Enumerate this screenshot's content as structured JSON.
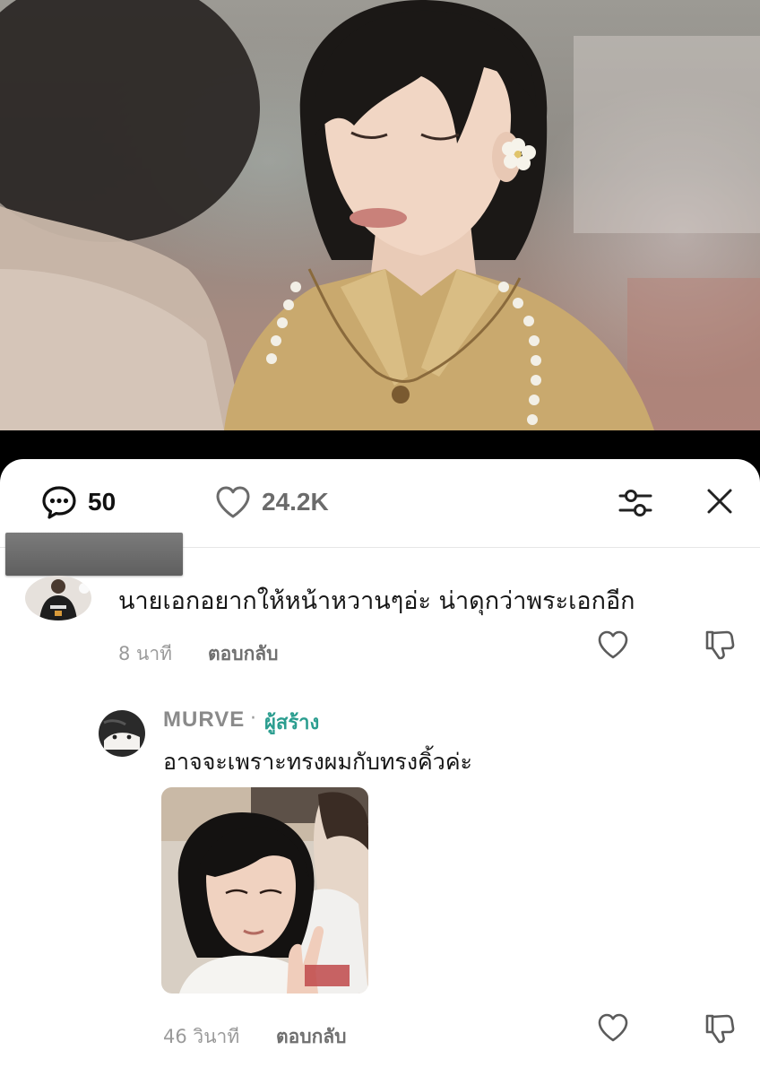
{
  "header": {
    "comment_count": "50",
    "like_count": "24.2K"
  },
  "comments": [
    {
      "text": "นายเอกอยากให้หน้าหวานๆอ่ะ น่าดุกว่าพระเอกอีก",
      "time": "8 นาที",
      "reply_label": "ตอบกลับ"
    }
  ],
  "reply": {
    "author": "MURVE",
    "separator": "·",
    "creator_badge": "ผู้สร้าง",
    "text": "อาจจะเพราะทรงผมกับทรงคิ้วค่ะ",
    "time": "46 วินาที",
    "reply_label": "ตอบกลับ"
  },
  "colors": {
    "creator_badge": "#2a9d8f",
    "meta_text": "#9a9a9a",
    "divider": "#e6e6e6"
  },
  "icons": [
    "comment-icon",
    "heart-icon",
    "filter-icon",
    "close-icon",
    "like-icon",
    "dislike-icon"
  ]
}
